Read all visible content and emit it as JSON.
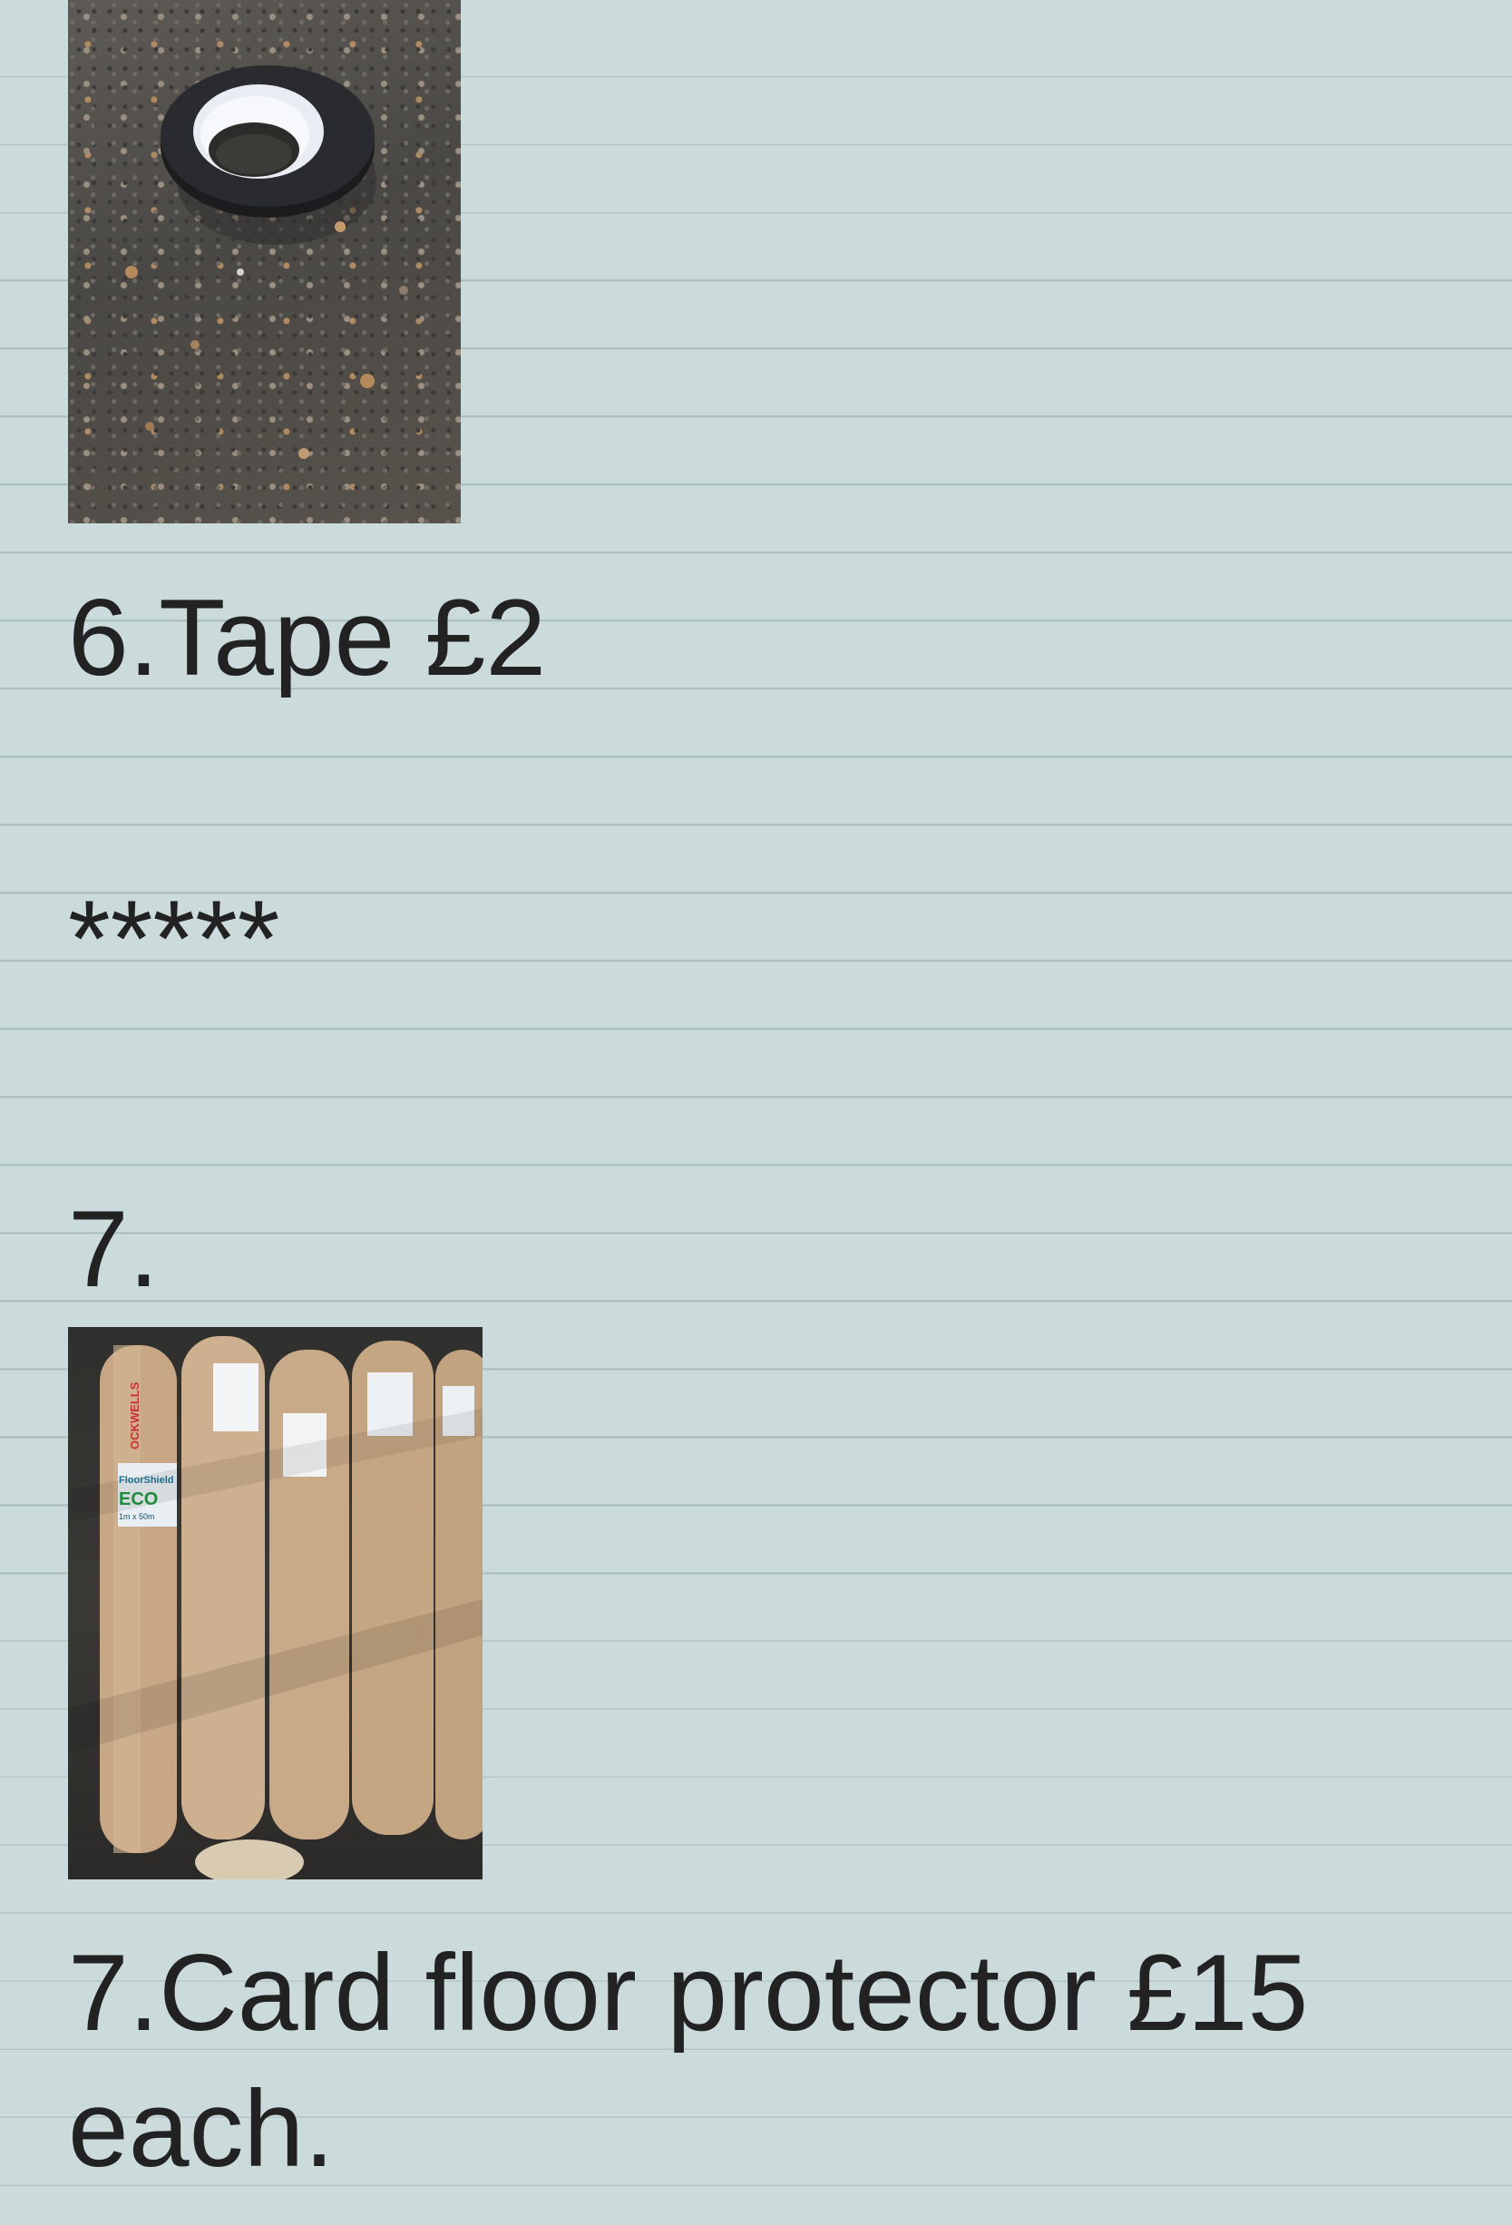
{
  "items": [
    {
      "photo": "tape-roll-photo",
      "caption": "6.Tape £2"
    },
    {
      "separator": "*****"
    },
    {
      "number": "7.",
      "photo": "floor-protector-rolls-photo",
      "photo_labels": {
        "brand": "OCKWELLS",
        "product": "FloorShield",
        "variant": "ECO",
        "size": "1m x 50m"
      },
      "caption_line1": "7.Card floor protector £15",
      "caption_line2": "each."
    }
  ]
}
